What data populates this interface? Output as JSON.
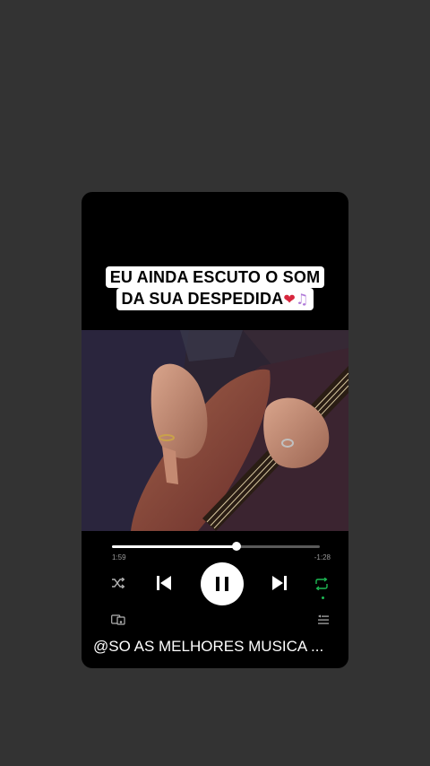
{
  "caption": {
    "line1": "EU AINDA ESCUTO O SOM",
    "line2": "DA SUA DESPEDIDA",
    "emoji_heart": "❤",
    "emoji_notes": "♫"
  },
  "player": {
    "elapsed": "1:59",
    "remaining": "-1:28",
    "progress": 0.6,
    "accent_color": "#1db954",
    "icons": {
      "shuffle": "shuffle-icon",
      "previous": "skip-previous-icon",
      "pause": "pause-icon",
      "next": "skip-next-icon",
      "repeat": "repeat-icon",
      "devices": "connect-devices-icon",
      "queue": "queue-icon"
    }
  },
  "footer": {
    "handle": "@SO AS MELHORES MUSICA ..."
  },
  "colors": {
    "background": "#333333",
    "card": "#000000",
    "caption_bg": "#ffffff"
  }
}
